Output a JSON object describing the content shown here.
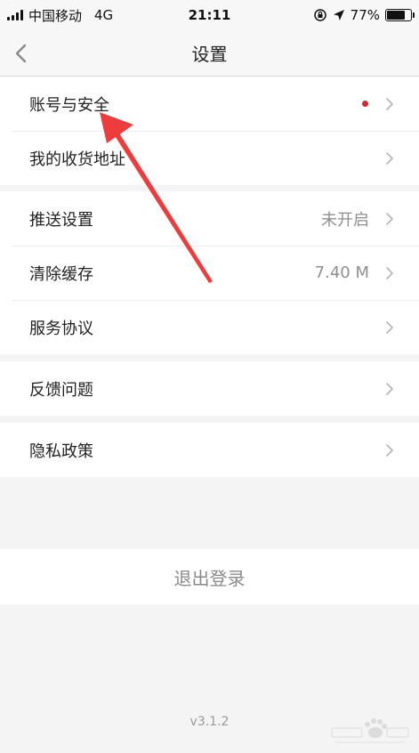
{
  "status_bar": {
    "carrier": "中国移动",
    "network": "4G",
    "time": "21:11",
    "battery_text": "77%",
    "battery_level": 0.77
  },
  "nav": {
    "title": "设置"
  },
  "groups": [
    {
      "rows": [
        {
          "label": "账号与安全",
          "badge": true
        },
        {
          "label": "我的收货地址"
        }
      ]
    },
    {
      "rows": [
        {
          "label": "推送设置",
          "value": "未开启"
        },
        {
          "label": "清除缓存",
          "value": "7.40 M"
        },
        {
          "label": "服务协议"
        }
      ]
    },
    {
      "rows": [
        {
          "label": "反馈问题"
        }
      ]
    },
    {
      "rows": [
        {
          "label": "隐私政策"
        }
      ]
    }
  ],
  "logout_label": "退出登录",
  "version": "v3.1.2",
  "colors": {
    "badge": "#e4212e",
    "arrow": "#ee3b3b",
    "background": "#f4f4f4"
  },
  "icons": {
    "back": "chevron-left-icon",
    "row_arrow": "chevron-right-icon",
    "location": "location-arrow-icon",
    "orientation_lock": "orientation-lock-icon"
  }
}
